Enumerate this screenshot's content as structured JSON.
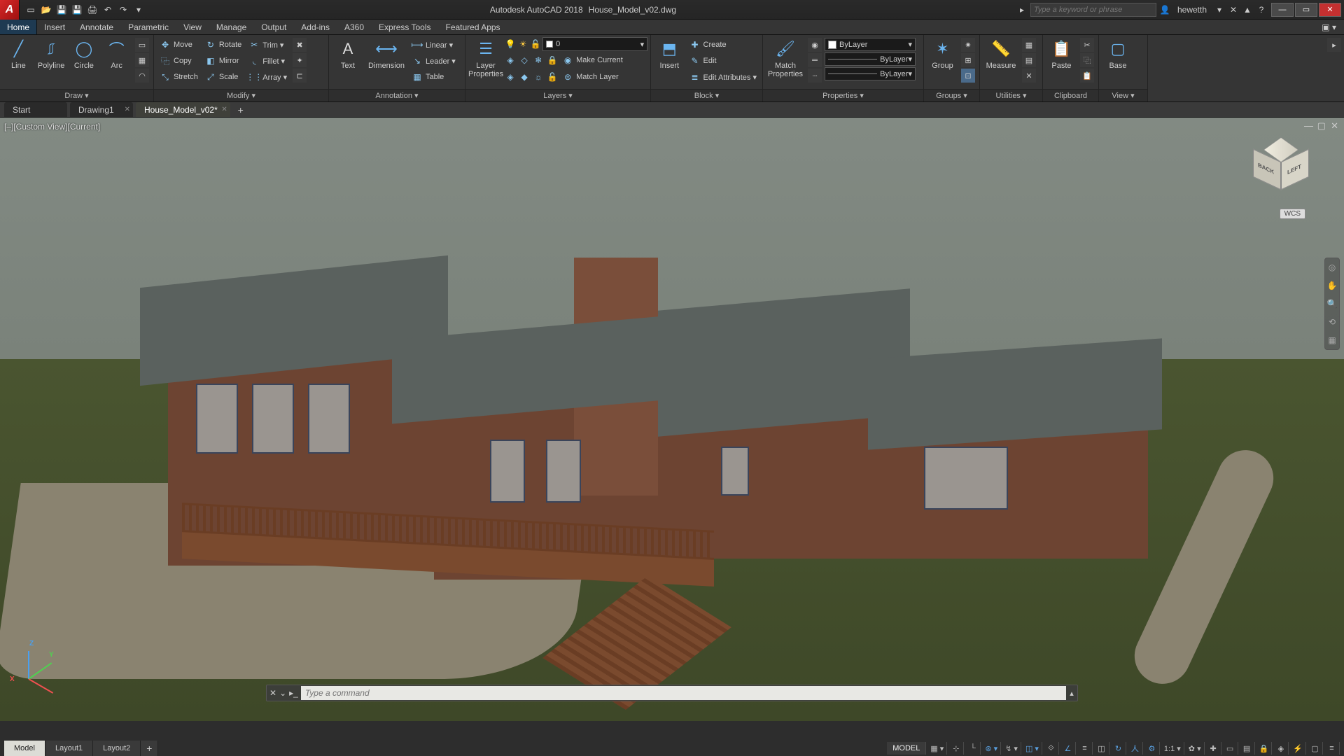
{
  "title": {
    "app": "Autodesk AutoCAD 2018",
    "file": "House_Model_v02.dwg"
  },
  "search_placeholder": "Type a keyword or phrase",
  "user": "hewetth",
  "menubar": [
    "Home",
    "Insert",
    "Annotate",
    "Parametric",
    "View",
    "Manage",
    "Output",
    "Add-ins",
    "A360",
    "Express Tools",
    "Featured Apps"
  ],
  "ribbon": {
    "draw": {
      "title": "Draw ▾",
      "line": "Line",
      "polyline": "Polyline",
      "circle": "Circle",
      "arc": "Arc"
    },
    "modify": {
      "title": "Modify ▾",
      "move": "Move",
      "rotate": "Rotate",
      "trim": "Trim ▾",
      "copy": "Copy",
      "mirror": "Mirror",
      "fillet": "Fillet ▾",
      "stretch": "Stretch",
      "scale": "Scale",
      "array": "Array ▾"
    },
    "annotation": {
      "title": "Annotation ▾",
      "text": "Text",
      "dimension": "Dimension",
      "linear": "Linear ▾",
      "leader": "Leader ▾",
      "table": "Table"
    },
    "layers": {
      "title": "Layers ▾",
      "props": "Layer\nProperties",
      "current_layer": "0",
      "make_current": "Make Current",
      "match_layer": "Match Layer"
    },
    "block": {
      "title": "Block ▾",
      "insert": "Insert",
      "create": "Create",
      "edit": "Edit",
      "edit_attr": "Edit Attributes ▾"
    },
    "properties": {
      "title": "Properties ▾",
      "match": "Match\nProperties",
      "c1": "ByLayer",
      "c2": "ByLayer",
      "c3": "ByLayer"
    },
    "groups": {
      "title": "Groups ▾",
      "group": "Group"
    },
    "utilities": {
      "title": "Utilities ▾",
      "measure": "Measure"
    },
    "clipboard": {
      "title": "Clipboard",
      "paste": "Paste"
    },
    "view": {
      "title": "View ▾",
      "base": "Base"
    }
  },
  "filetabs": [
    {
      "label": "Start",
      "active": false,
      "close": false
    },
    {
      "label": "Drawing1",
      "active": false,
      "close": true
    },
    {
      "label": "House_Model_v02*",
      "active": true,
      "close": true
    }
  ],
  "viewport_label": "[–][Custom View][Current]",
  "viewcube": {
    "back": "BACK",
    "left": "LEFT"
  },
  "wcs": "WCS",
  "cmd_placeholder": "Type a command",
  "layouts": [
    "Model",
    "Layout1",
    "Layout2"
  ],
  "status_model": "MODEL",
  "status_ratio": "1:1 ▾",
  "axis": {
    "x": "X",
    "y": "Y",
    "z": "Z"
  }
}
